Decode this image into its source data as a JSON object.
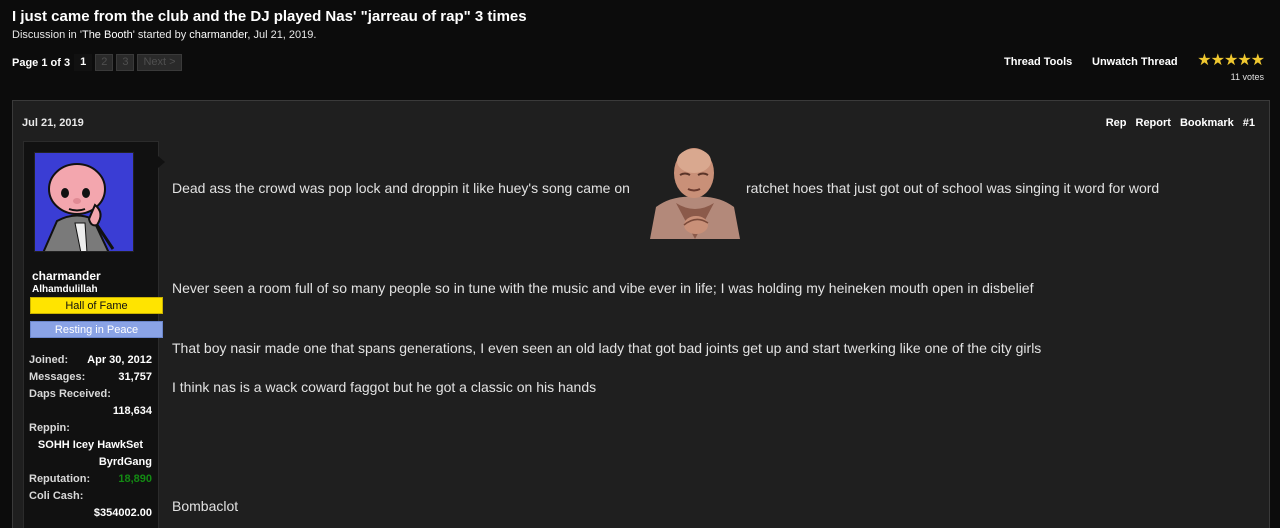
{
  "thread": {
    "title": "I just came from the club and the DJ played Nas' \"jarreau of rap\" 3 times",
    "discussion_prefix": "Discussion in '",
    "forum": "The Booth",
    "started_by_text": "' started by ",
    "author": "charmander",
    "date_text": ", Jul 21, 2019."
  },
  "pagination": {
    "label": "Page 1 of 3",
    "pages": [
      "1",
      "2",
      "3"
    ],
    "next": "Next >"
  },
  "tools": {
    "thread_tools": "Thread Tools",
    "unwatch": "Unwatch Thread"
  },
  "rating": {
    "stars": "★★★★★",
    "votes": "11 votes",
    "star_color": "#f0c830"
  },
  "post": {
    "date": "Jul 21, 2019",
    "links": [
      "Rep",
      "Report",
      "Bookmark",
      "#1"
    ],
    "messages": [
      "Dead ass the crowd was pop lock and droppin it like huey's song came on",
      "ratchet hoes that just got out of school was singing it word for word",
      "Never seen a room full of so many people so in tune with the music and vibe ever in life; I was holding my heineken mouth open in disbelief",
      "That boy nasir made one that spans generations, I even seen an old lady that got bad joints get up and start twerking like one of the city girls",
      "I think nas is a wack coward faggot but he got a classic on his hands",
      "Bombaclot"
    ]
  },
  "user": {
    "name": "charmander",
    "title": "Alhamdulillah",
    "banners": [
      "Hall of Fame",
      "Resting in Peace"
    ],
    "joined_label": "Joined:",
    "joined": "Apr 30, 2012",
    "messages_label": "Messages:",
    "messages": "31,757",
    "daps_label": "Daps Received:",
    "daps": "118,634",
    "reppin_label": "Reppin:",
    "reppin_line1": "SOHH Icey HawkSet",
    "reppin_line2": "ByrdGang",
    "reputation_label": "Reputation:",
    "reputation": "18,890",
    "coli_label": "Coli Cash:",
    "coli": "$354002.00"
  }
}
